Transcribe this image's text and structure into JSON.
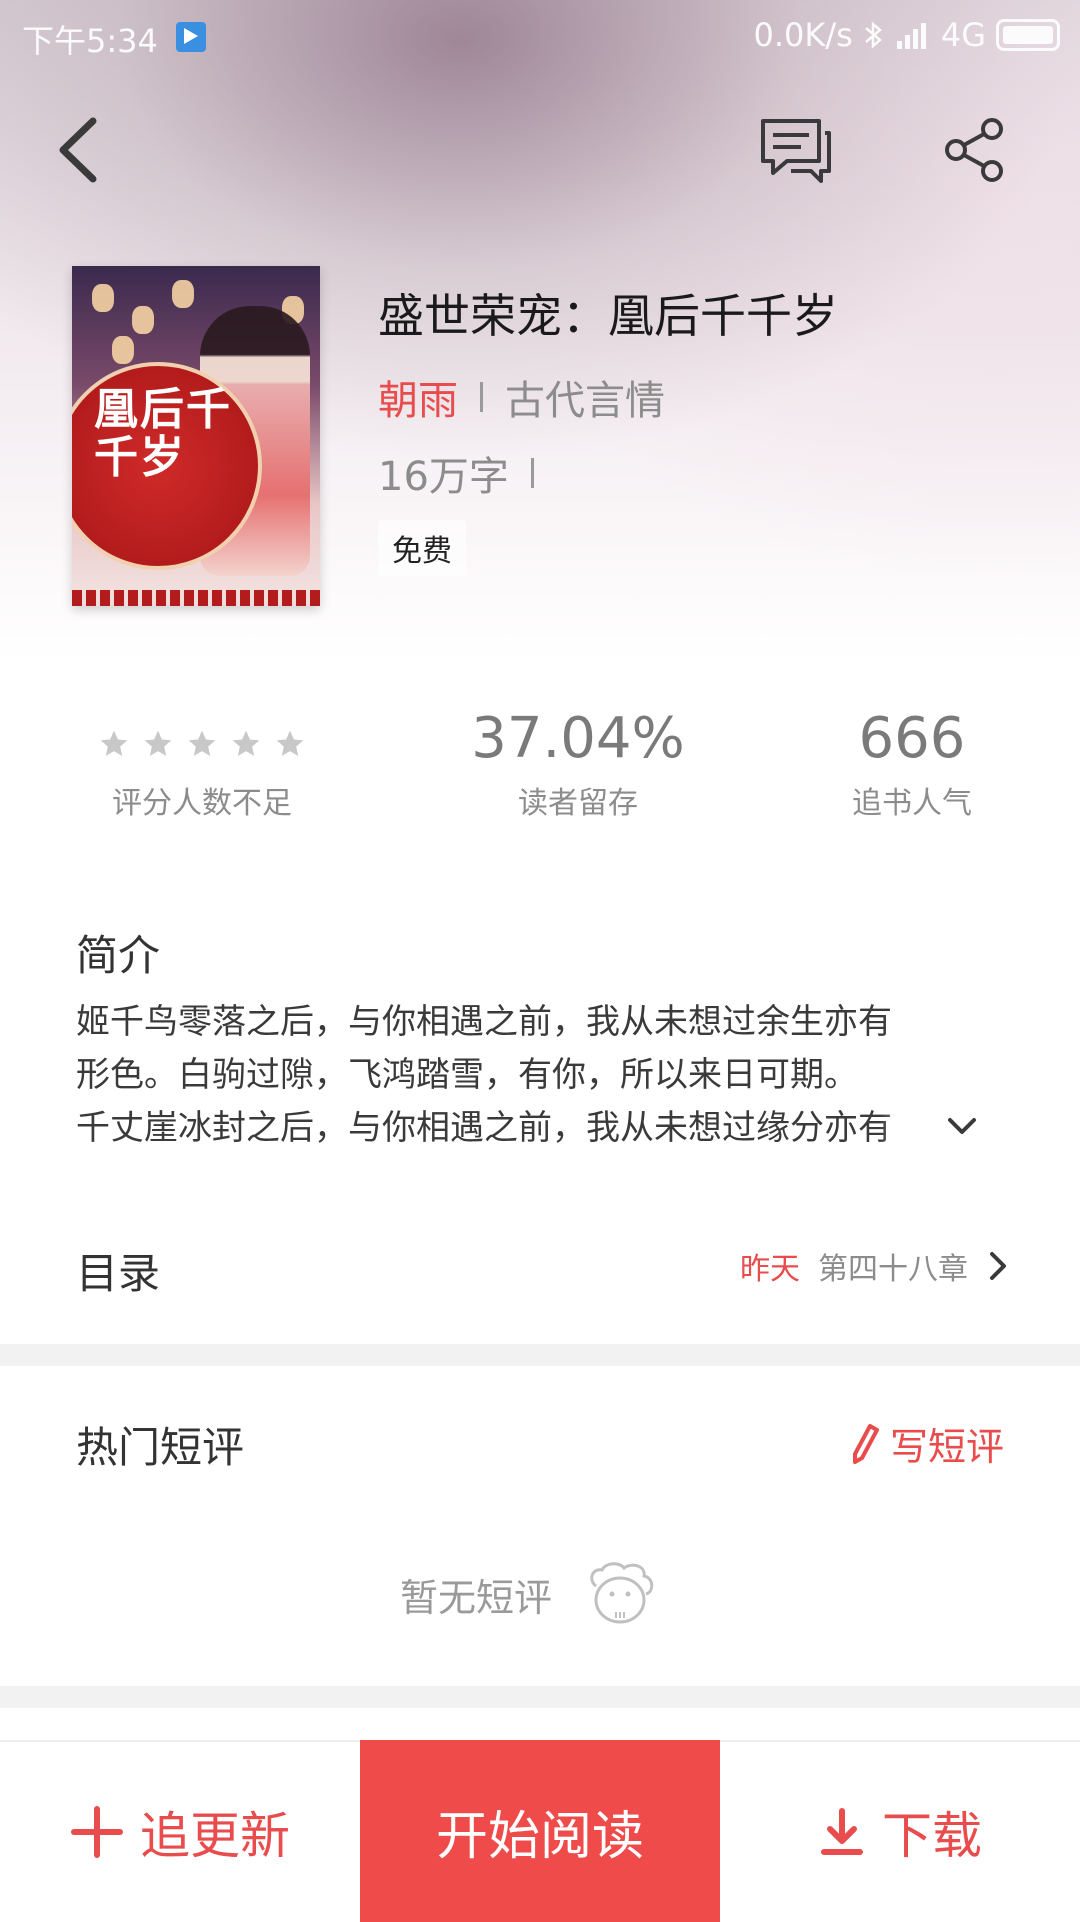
{
  "status_bar": {
    "time": "下午5:34",
    "network_speed": "0.0K/s",
    "network_type": "4G"
  },
  "nav": {
    "back_icon": "chevron-left-icon",
    "comment_icon": "comment-icon",
    "share_icon": "share-icon"
  },
  "book": {
    "title": "盛世荣宠：凰后千千岁",
    "author": "朝雨",
    "genre": "古代言情",
    "word_count": "16万字",
    "price_tag": "免费",
    "cover_text": "凰后千千岁"
  },
  "stats": {
    "rating": {
      "stars": 5,
      "label": "评分人数不足"
    },
    "retention": {
      "value": "37.04%",
      "label": "读者留存"
    },
    "popularity": {
      "value": "666",
      "label": "追书人气"
    }
  },
  "intro": {
    "title": "简介",
    "lines": [
      "姬千鸟零落之后，与你相遇之前，我从未想过余生亦有",
      "形色。白驹过隙，飞鸿踏雪，有你，所以来日可期。",
      "千丈崖冰封之后，与你相遇之前，我从未想过缘分亦有"
    ]
  },
  "toc": {
    "title": "目录",
    "updated": "昨天",
    "latest_chapter": "第四十八章"
  },
  "reviews": {
    "title": "热门短评",
    "write_label": "写短评",
    "empty_text": "暂无短评"
  },
  "bottom_bar": {
    "follow_label": "追更新",
    "read_label": "开始阅读",
    "download_label": "下载"
  },
  "colors": {
    "accent": "#e84c4c",
    "read_button": "#ef4b4b"
  }
}
